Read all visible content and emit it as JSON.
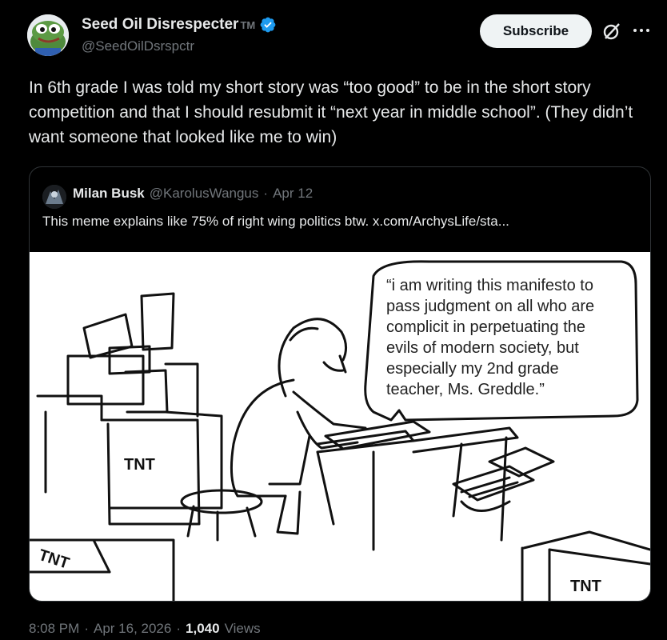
{
  "author": {
    "name": "Seed Oil Disrespecter",
    "tm": "TM",
    "handle": "@SeedOilDsrspctr"
  },
  "actions": {
    "subscribe_label": "Subscribe"
  },
  "tweet": {
    "text": "In 6th grade I was told my short story was “too good” to be in the short story competition and that I should resubmit it “next year in middle school”. (They didn’t want someone that looked like me to win)"
  },
  "quote": {
    "name": "Milan Busk",
    "handle": "@KarolusWangus",
    "dot": "·",
    "date": "Apr 12",
    "text": "This meme explains like 75% of right wing politics btw.  x.com/ArchysLife/sta..."
  },
  "comic": {
    "speech_lines": [
      "“i am writing this manifesto to",
      "pass judgment on all who are",
      "complicit in perpetuating the",
      "evils of modern society, but",
      "especially my 2nd grade",
      "teacher, Ms. Greddle.”"
    ],
    "tnt_labels": [
      "TNT",
      "TNT",
      "TNT"
    ]
  },
  "footer": {
    "time": "8:08 PM",
    "dot1": "·",
    "date": "Apr 16, 2026",
    "dot2": "·",
    "views_count": "1,040",
    "views_label": "Views"
  },
  "colors": {
    "background": "#000000",
    "text_primary": "#e7e9ea",
    "text_secondary": "#71767b",
    "verified": "#1d9bf0",
    "border": "#2f3336"
  }
}
